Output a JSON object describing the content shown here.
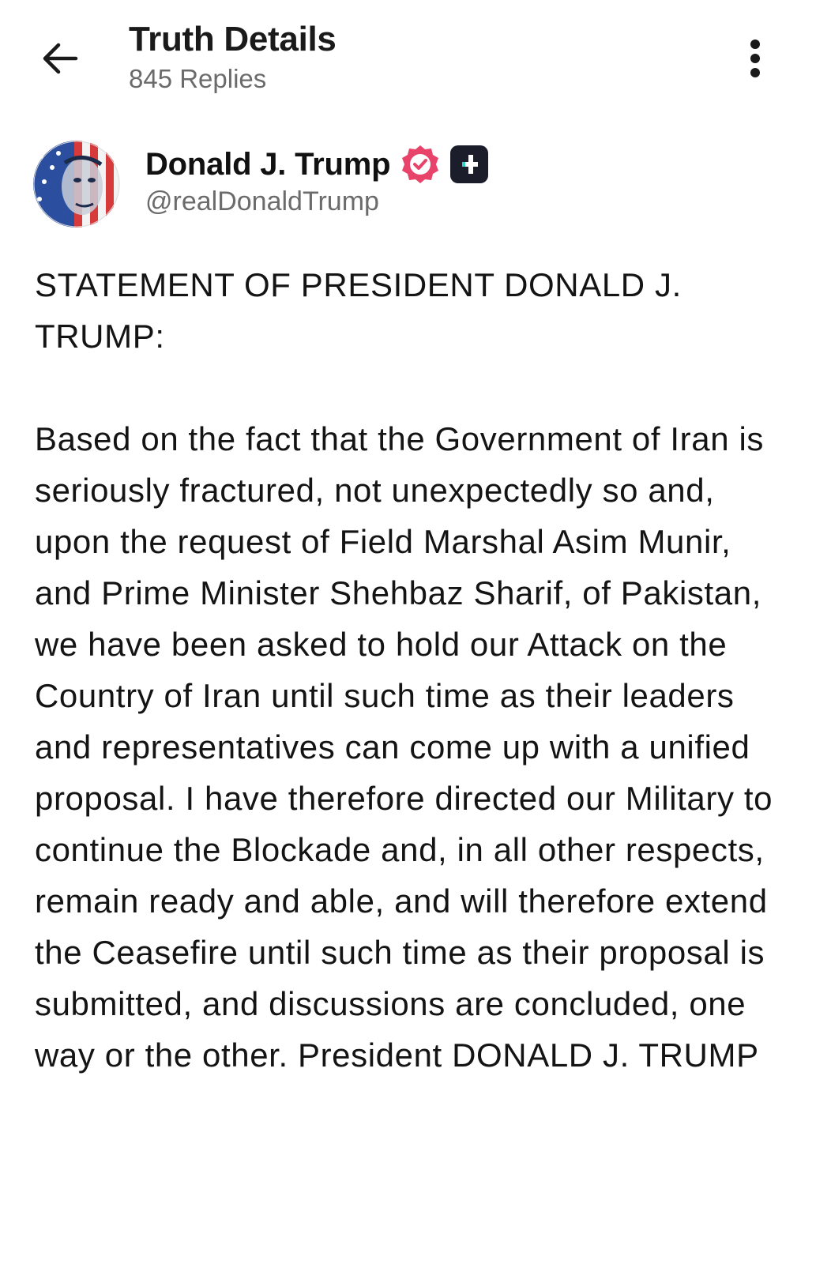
{
  "header": {
    "title": "Truth Details",
    "subtitle": "845 Replies",
    "back_icon": "arrow-left-icon",
    "more_icon": "more-vertical-icon"
  },
  "author": {
    "name": "Donald J. Trump",
    "handle": "@realDonaldTrump",
    "verified_icon": "verified-badge-icon",
    "verified_color": "#e8436a",
    "plus_icon": "truth-plus-icon"
  },
  "post": {
    "heading": "STATEMENT OF PRESIDENT DONALD J. TRUMP:",
    "body": "Based on the fact that the Government of Iran is seriously fractured, not unexpectedly so and, upon the request of Field Marshal Asim Munir, and Prime Minister Shehbaz Sharif, of Pakistan, we have been asked to hold our Attack on the Country of Iran until such time as their leaders and representatives can come up with a unified proposal. I have therefore directed our Military to continue the Blockade and, in all other respects, remain ready and able, and will therefore extend the Ceasefire until such time as their proposal is submitted, and discussions are concluded, one way or the other. President DONALD J. TRUMP"
  }
}
